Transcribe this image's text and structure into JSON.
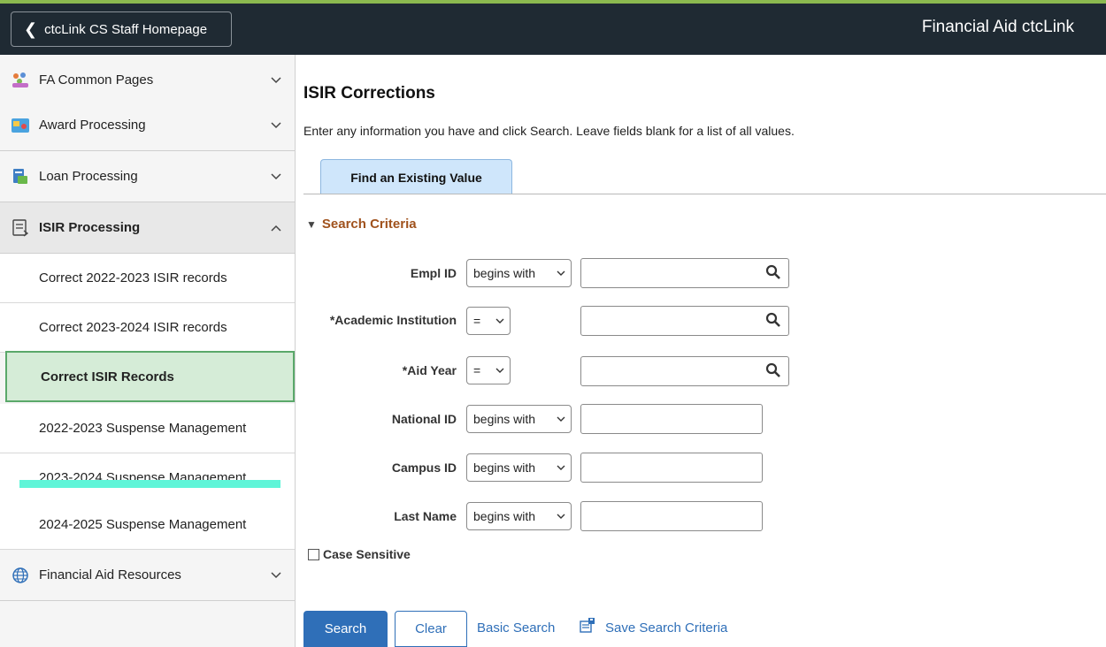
{
  "header": {
    "home_button": "ctcLink CS Staff Homepage",
    "title": "Financial Aid ctcLink"
  },
  "sidebar": {
    "groups": [
      {
        "label": "FA Common Pages",
        "icon": "people-icon"
      },
      {
        "label": "Award Processing",
        "icon": "award-card-icon"
      },
      {
        "label": "Loan Processing",
        "icon": "loan-icon"
      },
      {
        "label": "ISIR Processing",
        "icon": "document-icon",
        "expanded": true
      },
      {
        "label": "Financial Aid Resources",
        "icon": "globe-icon"
      }
    ],
    "items": [
      {
        "label": "Correct 2022-2023 ISIR records"
      },
      {
        "label": "Correct 2023-2024 ISIR records"
      },
      {
        "label": "Correct ISIR Records",
        "active": true
      },
      {
        "label": "2022-2023 Suspense Management"
      },
      {
        "label": "2023-2024 Suspense Management"
      },
      {
        "label": "2024-2025 Suspense Management"
      }
    ]
  },
  "main": {
    "title": "ISIR Corrections",
    "instructions": "Enter any information you have and click Search. Leave fields blank for a list of all values.",
    "tab": "Find an Existing Value",
    "section": "Search Criteria",
    "fields": [
      {
        "label": "Empl ID",
        "operator": "begins with",
        "value": "",
        "lookup": true
      },
      {
        "label": "*Academic Institution",
        "operator": "=",
        "value": "",
        "lookup": true
      },
      {
        "label": "*Aid Year",
        "operator": "=",
        "value": "",
        "lookup": true
      },
      {
        "label": "National ID",
        "operator": "begins with",
        "value": "",
        "lookup": false
      },
      {
        "label": "Campus ID",
        "operator": "begins with",
        "value": "",
        "lookup": false
      },
      {
        "label": "Last Name",
        "operator": "begins with",
        "value": "",
        "lookup": false
      }
    ],
    "case_sensitive_label": "Case Sensitive",
    "case_sensitive_checked": false,
    "buttons": {
      "search": "Search",
      "clear": "Clear",
      "basic_search": "Basic Search",
      "save_search": "Save Search Criteria"
    }
  },
  "colors": {
    "header_bg": "#1f2a33",
    "accent": "#8bb94f",
    "link": "#2f6fb8",
    "section_heading": "#a0521d",
    "active_item_bg": "#d5ecd7",
    "active_item_border": "#5aa86a",
    "tab_bg": "#cfe6fb"
  }
}
